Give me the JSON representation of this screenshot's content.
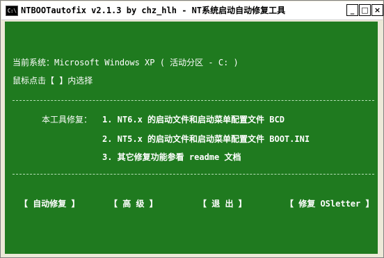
{
  "window": {
    "title": "NTBOOTautofix v2.1.3 by chz_hlh - NT系统启动自动修复工具",
    "icon_label": "C:\\",
    "controls": {
      "minimize": "_",
      "maximize": "□",
      "close": "×"
    }
  },
  "console": {
    "current_system": "当前系统：Microsoft Windows XP  ( 活动分区 - C: )",
    "instruction": "鼠标点击【 】内选择",
    "separator": "--------------------------------------------------------------------------------",
    "repair_label": "本工具修复：",
    "items": [
      "1. NT6.x 的启动文件和启动菜单配置文件 BCD",
      "2. NT5.x 的启动文件和启动菜单配置文件 BOOT.INI",
      "3. 其它修复功能参看 readme 文档"
    ]
  },
  "menu": {
    "auto_repair": "【 自动修复 】",
    "advanced": "【  高  级  】",
    "exit": "【  退  出  】",
    "repair_osletter": "【 修复 OSletter 】"
  },
  "colors": {
    "console_bg": "#1F7A1F",
    "console_text": "#ffffff",
    "titlebar_bg": "#ffffff"
  }
}
